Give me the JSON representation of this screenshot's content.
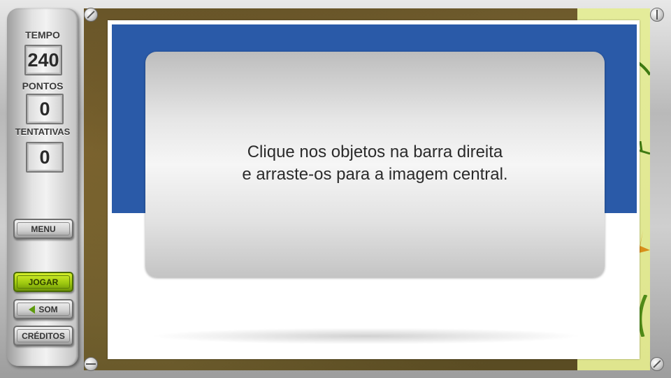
{
  "sidebar": {
    "stats": [
      {
        "label": "TEMPO",
        "value": "240"
      },
      {
        "label": "PONTOS",
        "value": "0"
      },
      {
        "label": "TENTATIVAS",
        "value": "0"
      }
    ],
    "buttons": {
      "menu": "MENU",
      "play": "JOGAR",
      "sound": "SOM",
      "credits": "CRÉDITOS"
    }
  },
  "dialog": {
    "text": "Clique nos objetos na barra direita\ne arraste-os para a imagem central."
  },
  "colors": {
    "panel_blue": "#2a5aa8",
    "play_button_green": "#9bc60f",
    "side_scene": "#e0e790"
  },
  "icons": [
    "screw-icon",
    "speaker-icon"
  ]
}
